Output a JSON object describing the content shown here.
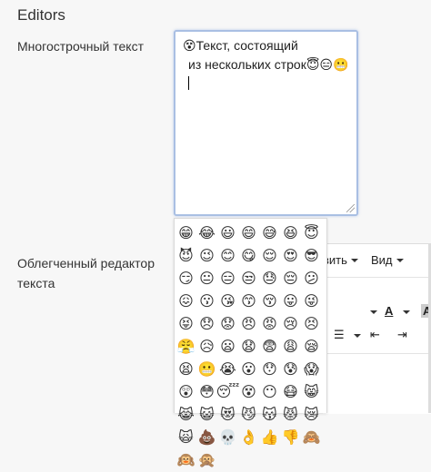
{
  "section": {
    "title": "Editors"
  },
  "multiline": {
    "label": "Многострочный текст",
    "line1": "😵Текст, состоящий",
    "line2": "из нескольких строк😇😑😬"
  },
  "light_editor": {
    "label": "Облегченный редактор текста",
    "menu": {
      "insert_label": "вить",
      "view_label": "Вид"
    },
    "toolbar": {
      "font_color": "A",
      "highlight": "A",
      "list": "☰",
      "outdent": "⇤",
      "indent": "⇥"
    }
  },
  "emoji_picker": {
    "emojis": [
      "😁",
      "😂",
      "😃",
      "😄",
      "😅",
      "😆",
      "😇",
      "😈",
      "😉",
      "😊",
      "😋",
      "😌",
      "😍",
      "😎",
      "😏",
      "😐",
      "😑",
      "😒",
      "😓",
      "😔",
      "😕",
      "😖",
      "😗",
      "😘",
      "😙",
      "😚",
      "😛",
      "😜",
      "😝",
      "😞",
      "😟",
      "😠",
      "😡",
      "😢",
      "😣",
      "😤",
      "😥",
      "😦",
      "😧",
      "😨",
      "😩",
      "😪",
      "😫",
      "😬",
      "😭",
      "😮",
      "😯",
      "😰",
      "😱",
      "😲",
      "😳",
      "😴",
      "😵",
      "😶",
      "😷",
      "😸",
      "😹",
      "😺",
      "😻",
      "😼",
      "😽",
      "😾",
      "😿",
      "🙀",
      "💩",
      "💀",
      "👌",
      "👍",
      "👎",
      "🙈",
      "🙉",
      "🙊"
    ]
  }
}
